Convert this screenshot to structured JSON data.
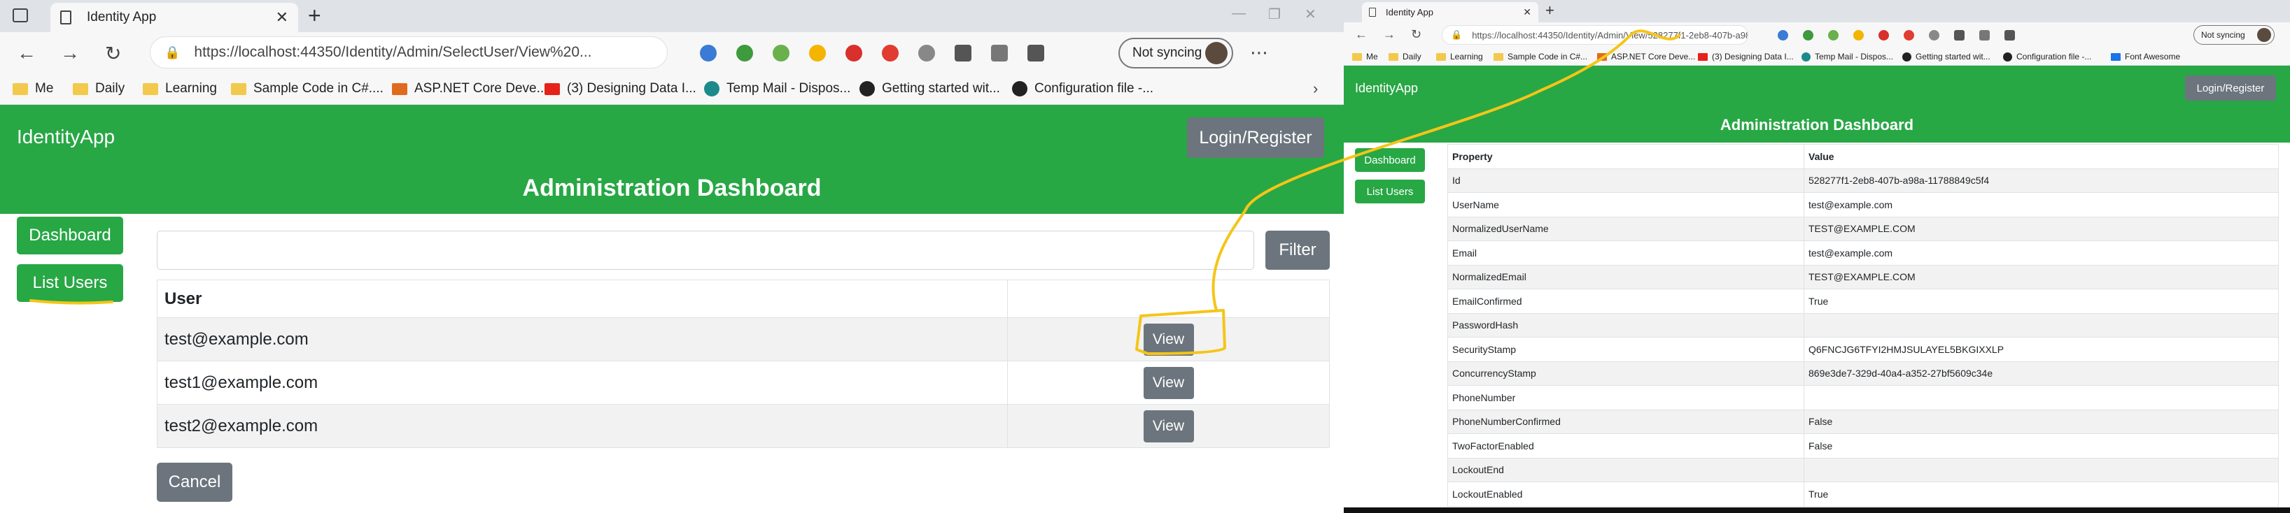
{
  "left_browser": {
    "tab_title": "Identity App",
    "address": "https://localhost:44350/Identity/Admin/SelectUser/View%20...",
    "sync_label": "Not syncing",
    "bookmarks": [
      {
        "label": "Me",
        "icon": "folder"
      },
      {
        "label": "Daily",
        "icon": "folder"
      },
      {
        "label": "Learning",
        "icon": "folder"
      },
      {
        "label": "Sample Code in C#....",
        "icon": "folder"
      },
      {
        "label": "ASP.NET Core Deve...",
        "icon": "grid-icon"
      },
      {
        "label": "(3) Designing Data I...",
        "icon": "youtube-icon"
      },
      {
        "label": "Temp Mail - Dispos...",
        "icon": "tempmail-icon"
      },
      {
        "label": "Getting started wit...",
        "icon": "github-icon"
      },
      {
        "label": "Configuration file -...",
        "icon": "github-icon"
      }
    ]
  },
  "left_app": {
    "brand": "IdentityApp",
    "login_label": "Login/Register",
    "dashboard_title": "Administration Dashboard",
    "sidebar": [
      {
        "label": "Dashboard"
      },
      {
        "label": "List Users"
      }
    ],
    "filter_placeholder": "",
    "filter_label": "Filter",
    "table_header": "User",
    "users": [
      {
        "email": "test@example.com",
        "action": "View"
      },
      {
        "email": "test1@example.com",
        "action": "View"
      },
      {
        "email": "test2@example.com",
        "action": "View"
      }
    ],
    "cancel_label": "Cancel"
  },
  "right_browser": {
    "tab_title": "Identity App",
    "address": "https://localhost:44350/Identity/Admin/View/528277f1-2eb8-407b-a98a-1...",
    "sync_label": "Not syncing",
    "bookmarks": [
      {
        "label": "Me",
        "icon": "folder"
      },
      {
        "label": "Daily",
        "icon": "folder"
      },
      {
        "label": "Learning",
        "icon": "folder"
      },
      {
        "label": "Sample Code in C#...",
        "icon": "folder"
      },
      {
        "label": "ASP.NET Core Deve...",
        "icon": "grid-icon"
      },
      {
        "label": "(3) Designing Data I...",
        "icon": "youtube-icon"
      },
      {
        "label": "Temp Mail - Dispos...",
        "icon": "tempmail-icon"
      },
      {
        "label": "Getting started wit...",
        "icon": "github-icon"
      },
      {
        "label": "Configuration file -...",
        "icon": "github-icon"
      },
      {
        "label": "Font Awesome",
        "icon": "flag-icon"
      }
    ]
  },
  "right_app": {
    "brand": "IdentityApp",
    "login_label": "Login/Register",
    "dashboard_title": "Administration Dashboard",
    "sidebar": [
      {
        "label": "Dashboard"
      },
      {
        "label": "List Users"
      }
    ],
    "table_headers": {
      "property": "Property",
      "value": "Value"
    },
    "properties": [
      {
        "property": "Id",
        "value": "528277f1-2eb8-407b-a98a-11788849c5f4"
      },
      {
        "property": "UserName",
        "value": "test@example.com"
      },
      {
        "property": "NormalizedUserName",
        "value": "TEST@EXAMPLE.COM"
      },
      {
        "property": "Email",
        "value": "test@example.com"
      },
      {
        "property": "NormalizedEmail",
        "value": "TEST@EXAMPLE.COM"
      },
      {
        "property": "EmailConfirmed",
        "value": "True"
      },
      {
        "property": "PasswordHash",
        "value": ""
      },
      {
        "property": "SecurityStamp",
        "value": "Q6FNCJG6TFYI2HMJSULAYEL5BKGIXXLP"
      },
      {
        "property": "ConcurrencyStamp",
        "value": "869e3de7-329d-40a4-a352-27bf5609c34e"
      },
      {
        "property": "PhoneNumber",
        "value": ""
      },
      {
        "property": "PhoneNumberConfirmed",
        "value": "False"
      },
      {
        "property": "TwoFactorEnabled",
        "value": "False"
      },
      {
        "property": "LockoutEnd",
        "value": ""
      },
      {
        "property": "LockoutEnabled",
        "value": "True"
      }
    ]
  },
  "colors": {
    "brand_green": "#28a745",
    "secondary_gray": "#6c757d",
    "annotation_yellow": "#f5c518"
  }
}
